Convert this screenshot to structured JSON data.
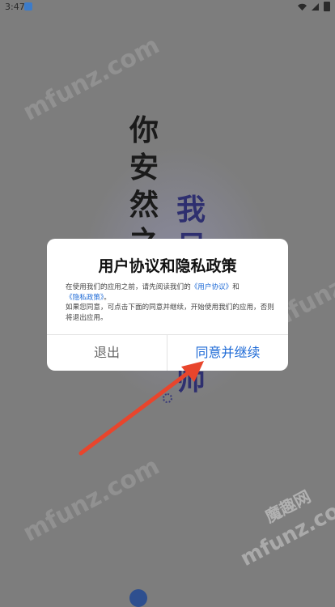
{
  "status_bar": {
    "time": "3:47"
  },
  "splash": {
    "column_1": [
      "你",
      "安",
      "然",
      "之"
    ],
    "column_2": [
      "我",
      "尽"
    ],
    "column_3": [
      "师"
    ]
  },
  "dialog": {
    "title": "用户协议和隐私政策",
    "body_line1_prefix": "在使用我们的应用之前，请先阅读我们的",
    "user_agreement_link": "《用户协议》",
    "and_text": "和",
    "privacy_policy_link": "《隐私政策》",
    "period": "。",
    "body_line3": "如果您同意，可点击下面的同意并继续，开始使用我们的应用，否则将退出应用。",
    "exit_label": "退出",
    "agree_label": "同意并继续"
  },
  "watermarks": {
    "mfunz_1": "mfunz.com",
    "mfunz_2": "mfunz.com",
    "mfunz_3": "mfunz.com",
    "mfunz_4": "mfunz.com",
    "brand": "魔趣网"
  },
  "colors": {
    "link": "#1e6ad6",
    "arrow": "#e8452c",
    "poem_accent": "#2e2f6f"
  }
}
